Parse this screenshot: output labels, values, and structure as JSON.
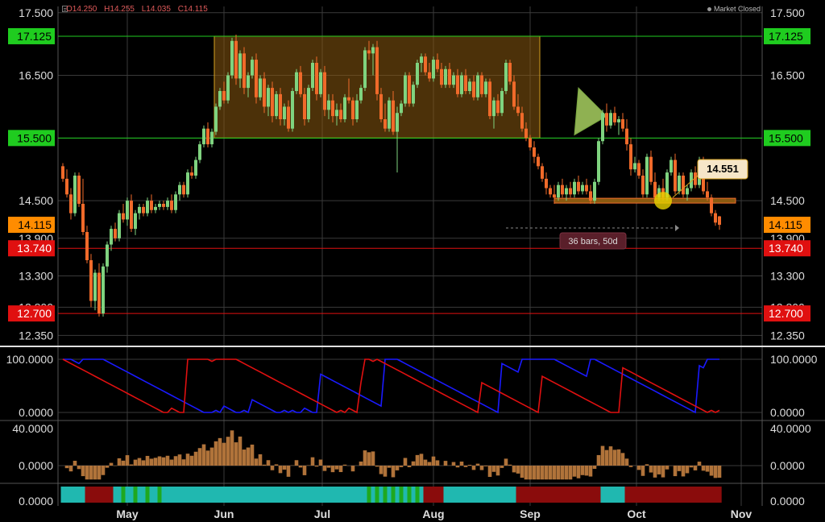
{
  "ohlc": {
    "open": "O14.250",
    "high": "H14.255",
    "low": "L14.035",
    "close": "C14.115"
  },
  "market_status": "Market Closed",
  "colors": {
    "up": "#7fd37f",
    "down": "#f06a2a",
    "grid": "#3a3a3a",
    "green_level": "#1fcc1f",
    "red_level": "#e01010",
    "orange_label": "#ff8c00",
    "stoch_blue": "#1a1aff",
    "stoch_red": "#e01010",
    "hist": "#b0733a",
    "box_fill": "#8a5a10",
    "box_border": "#d4a020",
    "callout_bg": "#f6e6c8"
  },
  "chart_data": {
    "type": "candlestick",
    "x_labels": [
      "May",
      "Jun",
      "Jul",
      "Aug",
      "Sep",
      "Oct",
      "Nov"
    ],
    "price_axis_ticks": [
      "17.500",
      "16.500",
      "14.500",
      "13.900",
      "13.300",
      "12.800",
      "12.350"
    ],
    "price_ylim": [
      12.2,
      17.6
    ],
    "levels": [
      {
        "label": "17.125",
        "value": 17.125,
        "color": "green"
      },
      {
        "label": "15.500",
        "value": 15.5,
        "color": "green"
      },
      {
        "label": "13.740",
        "value": 13.74,
        "color": "red"
      },
      {
        "label": "12.700",
        "value": 12.7,
        "color": "red"
      }
    ],
    "last_price_label": "14.115",
    "last_price": 14.115,
    "callout": {
      "label": "14.551",
      "value": 14.551
    },
    "range_box": {
      "top": 17.125,
      "bottom": 15.5,
      "from_bar": 38,
      "to_bar": 118
    },
    "support_line": {
      "value": 14.5,
      "from_bar": 122,
      "to_bar": 167
    },
    "measure": {
      "label": "36 bars, 50d"
    },
    "stochastic": {
      "ticks": [
        "100.0000",
        "0.0000"
      ]
    },
    "histogram": {
      "ticks": [
        "40.0000",
        "0.0000"
      ]
    },
    "ribbon": {
      "ticks": [
        "0.0000"
      ]
    },
    "candles": [
      [
        15.05,
        15.1,
        14.8,
        14.85
      ],
      [
        14.85,
        15.0,
        14.55,
        14.6
      ],
      [
        14.6,
        14.7,
        14.2,
        14.3
      ],
      [
        14.3,
        14.95,
        14.25,
        14.9
      ],
      [
        14.9,
        14.95,
        14.4,
        14.45
      ],
      [
        14.45,
        14.85,
        13.95,
        14.0
      ],
      [
        14.0,
        14.1,
        13.5,
        13.55
      ],
      [
        13.55,
        13.65,
        12.8,
        12.9
      ],
      [
        12.9,
        13.4,
        12.75,
        13.35
      ],
      [
        13.35,
        13.5,
        12.65,
        12.7
      ],
      [
        12.7,
        13.5,
        12.65,
        13.45
      ],
      [
        13.45,
        13.85,
        13.35,
        13.8
      ],
      [
        13.8,
        14.1,
        13.7,
        14.05
      ],
      [
        14.05,
        14.15,
        13.85,
        13.9
      ],
      [
        13.9,
        14.35,
        13.85,
        14.3
      ],
      [
        14.3,
        14.45,
        14.15,
        14.2
      ],
      [
        14.2,
        14.55,
        14.1,
        14.5
      ],
      [
        14.5,
        14.6,
        14.0,
        14.05
      ],
      [
        14.05,
        14.35,
        13.95,
        14.3
      ],
      [
        14.3,
        14.45,
        14.2,
        14.4
      ],
      [
        14.4,
        14.45,
        14.25,
        14.3
      ],
      [
        14.3,
        14.55,
        14.25,
        14.5
      ],
      [
        14.5,
        14.6,
        14.3,
        14.35
      ],
      [
        14.35,
        14.45,
        14.3,
        14.4
      ],
      [
        14.4,
        14.5,
        14.35,
        14.45
      ],
      [
        14.45,
        14.5,
        14.35,
        14.4
      ],
      [
        14.4,
        14.55,
        14.35,
        14.5
      ],
      [
        14.5,
        14.6,
        14.3,
        14.35
      ],
      [
        14.35,
        14.65,
        14.3,
        14.6
      ],
      [
        14.6,
        14.8,
        14.5,
        14.75
      ],
      [
        14.75,
        14.8,
        14.55,
        14.6
      ],
      [
        14.6,
        15.0,
        14.55,
        14.95
      ],
      [
        14.95,
        15.05,
        14.85,
        14.9
      ],
      [
        14.9,
        15.2,
        14.85,
        15.15
      ],
      [
        15.15,
        15.45,
        15.1,
        15.4
      ],
      [
        15.4,
        15.7,
        15.35,
        15.65
      ],
      [
        15.65,
        15.75,
        15.35,
        15.4
      ],
      [
        15.4,
        15.65,
        15.35,
        15.6
      ],
      [
        15.6,
        16.05,
        15.55,
        16.0
      ],
      [
        16.0,
        16.3,
        15.95,
        16.25
      ],
      [
        16.25,
        16.4,
        16.05,
        16.1
      ],
      [
        16.1,
        16.55,
        16.05,
        16.5
      ],
      [
        16.5,
        17.1,
        16.45,
        17.05
      ],
      [
        17.05,
        17.15,
        16.35,
        16.45
      ],
      [
        16.45,
        16.9,
        16.3,
        16.85
      ],
      [
        16.85,
        16.95,
        16.2,
        16.3
      ],
      [
        16.3,
        16.55,
        16.15,
        16.5
      ],
      [
        16.5,
        16.8,
        16.45,
        16.75
      ],
      [
        16.75,
        16.85,
        16.05,
        16.15
      ],
      [
        16.15,
        16.5,
        16.1,
        16.45
      ],
      [
        16.45,
        16.55,
        15.9,
        16.0
      ],
      [
        16.0,
        16.35,
        15.85,
        16.3
      ],
      [
        16.3,
        16.4,
        15.75,
        15.85
      ],
      [
        15.85,
        16.25,
        15.8,
        16.2
      ],
      [
        16.2,
        16.3,
        15.7,
        15.8
      ],
      [
        15.8,
        16.05,
        15.7,
        16.0
      ],
      [
        16.0,
        16.1,
        15.6,
        15.65
      ],
      [
        15.65,
        16.3,
        15.6,
        16.25
      ],
      [
        16.25,
        16.6,
        16.2,
        16.55
      ],
      [
        16.55,
        16.65,
        16.15,
        16.2
      ],
      [
        16.2,
        16.3,
        15.7,
        15.8
      ],
      [
        15.8,
        16.35,
        15.75,
        16.3
      ],
      [
        16.3,
        16.75,
        16.25,
        16.7
      ],
      [
        16.7,
        16.8,
        16.1,
        16.2
      ],
      [
        16.2,
        16.6,
        16.15,
        16.55
      ],
      [
        16.55,
        16.65,
        15.85,
        15.95
      ],
      [
        15.95,
        16.2,
        15.8,
        16.1
      ],
      [
        16.1,
        16.2,
        15.75,
        15.85
      ],
      [
        15.85,
        16.05,
        15.7,
        15.95
      ],
      [
        15.95,
        16.05,
        15.75,
        15.8
      ],
      [
        15.8,
        16.2,
        15.75,
        16.15
      ],
      [
        16.15,
        16.45,
        16.05,
        16.1
      ],
      [
        16.1,
        16.15,
        15.7,
        15.8
      ],
      [
        15.8,
        16.2,
        15.75,
        16.1
      ],
      [
        16.1,
        16.35,
        16.05,
        16.3
      ],
      [
        16.3,
        16.95,
        16.25,
        16.9
      ],
      [
        16.9,
        17.05,
        16.75,
        16.85
      ],
      [
        16.85,
        17.0,
        16.5,
        16.95
      ],
      [
        16.95,
        17.05,
        16.1,
        16.2
      ],
      [
        16.2,
        16.3,
        15.75,
        15.8
      ],
      [
        15.8,
        16.05,
        15.6,
        15.65
      ],
      [
        15.65,
        16.15,
        15.6,
        16.1
      ],
      [
        16.1,
        16.25,
        15.55,
        15.6
      ],
      [
        15.6,
        16.0,
        14.95,
        15.9
      ],
      [
        15.9,
        16.1,
        15.85,
        16.05
      ],
      [
        16.05,
        16.55,
        16.0,
        16.5
      ],
      [
        16.5,
        16.55,
        16.0,
        16.05
      ],
      [
        16.05,
        16.4,
        16.0,
        16.35
      ],
      [
        16.35,
        16.75,
        16.3,
        16.7
      ],
      [
        16.7,
        16.85,
        16.55,
        16.8
      ],
      [
        16.8,
        16.85,
        16.5,
        16.55
      ],
      [
        16.55,
        16.7,
        16.4,
        16.45
      ],
      [
        16.45,
        16.8,
        16.4,
        16.75
      ],
      [
        16.75,
        16.85,
        16.55,
        16.6
      ],
      [
        16.6,
        16.7,
        16.3,
        16.35
      ],
      [
        16.35,
        16.65,
        16.3,
        16.6
      ],
      [
        16.6,
        16.7,
        16.3,
        16.35
      ],
      [
        16.35,
        16.55,
        16.3,
        16.5
      ],
      [
        16.5,
        16.6,
        16.15,
        16.2
      ],
      [
        16.2,
        16.55,
        16.15,
        16.5
      ],
      [
        16.5,
        16.6,
        16.2,
        16.25
      ],
      [
        16.25,
        16.45,
        16.2,
        16.4
      ],
      [
        16.4,
        16.5,
        16.1,
        16.15
      ],
      [
        16.15,
        16.55,
        16.1,
        16.5
      ],
      [
        16.5,
        16.55,
        16.15,
        16.2
      ],
      [
        16.2,
        16.45,
        16.15,
        16.4
      ],
      [
        16.4,
        16.45,
        15.8,
        15.85
      ],
      [
        15.85,
        16.15,
        15.65,
        16.1
      ],
      [
        16.1,
        16.2,
        15.85,
        15.9
      ],
      [
        15.9,
        16.3,
        15.85,
        16.25
      ],
      [
        16.25,
        16.75,
        16.2,
        16.7
      ],
      [
        16.7,
        16.75,
        16.35,
        16.4
      ],
      [
        16.4,
        16.5,
        15.95,
        16.0
      ],
      [
        16.0,
        16.2,
        15.85,
        15.9
      ],
      [
        15.9,
        16.0,
        15.6,
        15.65
      ],
      [
        15.65,
        15.75,
        15.45,
        15.5
      ],
      [
        15.5,
        15.55,
        15.3,
        15.35
      ],
      [
        15.35,
        15.45,
        15.1,
        15.2
      ],
      [
        15.2,
        15.25,
        15.0,
        15.05
      ],
      [
        15.05,
        15.1,
        14.8,
        14.85
      ],
      [
        14.85,
        14.95,
        14.6,
        14.7
      ],
      [
        14.7,
        14.75,
        14.55,
        14.6
      ],
      [
        14.6,
        14.75,
        14.45,
        14.55
      ],
      [
        14.55,
        14.8,
        14.5,
        14.75
      ],
      [
        14.75,
        14.85,
        14.55,
        14.6
      ],
      [
        14.6,
        14.75,
        14.5,
        14.7
      ],
      [
        14.7,
        14.8,
        14.55,
        14.6
      ],
      [
        14.6,
        14.85,
        14.55,
        14.8
      ],
      [
        14.8,
        14.9,
        14.6,
        14.65
      ],
      [
        14.65,
        14.8,
        14.6,
        14.75
      ],
      [
        14.75,
        14.85,
        14.6,
        14.65
      ],
      [
        14.65,
        14.75,
        14.45,
        14.5
      ],
      [
        14.5,
        14.85,
        14.45,
        14.8
      ],
      [
        14.8,
        15.5,
        14.75,
        15.45
      ],
      [
        15.45,
        15.95,
        15.4,
        15.9
      ],
      [
        15.9,
        16.05,
        15.6,
        15.7
      ],
      [
        15.7,
        15.95,
        15.65,
        15.9
      ],
      [
        15.9,
        16.0,
        15.7,
        15.75
      ],
      [
        15.75,
        15.85,
        15.55,
        15.8
      ],
      [
        15.8,
        15.9,
        15.6,
        15.65
      ],
      [
        15.65,
        15.8,
        15.3,
        15.4
      ],
      [
        15.4,
        15.5,
        14.9,
        15.0
      ],
      [
        15.0,
        15.2,
        14.95,
        15.1
      ],
      [
        15.1,
        15.15,
        14.85,
        14.9
      ],
      [
        14.9,
        15.0,
        14.55,
        14.6
      ],
      [
        14.6,
        15.25,
        14.55,
        15.2
      ],
      [
        15.2,
        15.3,
        14.75,
        14.8
      ],
      [
        14.8,
        14.95,
        14.5,
        14.55
      ],
      [
        14.55,
        14.75,
        14.5,
        14.7
      ],
      [
        14.7,
        14.85,
        14.5,
        14.55
      ],
      [
        14.55,
        15.0,
        14.5,
        14.95
      ],
      [
        14.95,
        15.2,
        14.9,
        15.15
      ],
      [
        15.15,
        15.25,
        14.6,
        14.65
      ],
      [
        14.65,
        14.95,
        14.6,
        14.9
      ],
      [
        14.9,
        14.95,
        14.55,
        14.6
      ],
      [
        14.6,
        14.75,
        14.5,
        14.7
      ],
      [
        14.7,
        15.0,
        14.65,
        14.95
      ],
      [
        14.95,
        15.05,
        14.7,
        14.75
      ],
      [
        14.75,
        15.2,
        14.7,
        15.15
      ],
      [
        15.15,
        15.2,
        14.6,
        14.65
      ],
      [
        14.65,
        14.8,
        14.5,
        14.55
      ],
      [
        14.55,
        14.6,
        14.25,
        14.3
      ],
      [
        14.3,
        14.35,
        14.1,
        14.15
      ],
      [
        14.25,
        14.255,
        14.035,
        14.115
      ]
    ]
  }
}
